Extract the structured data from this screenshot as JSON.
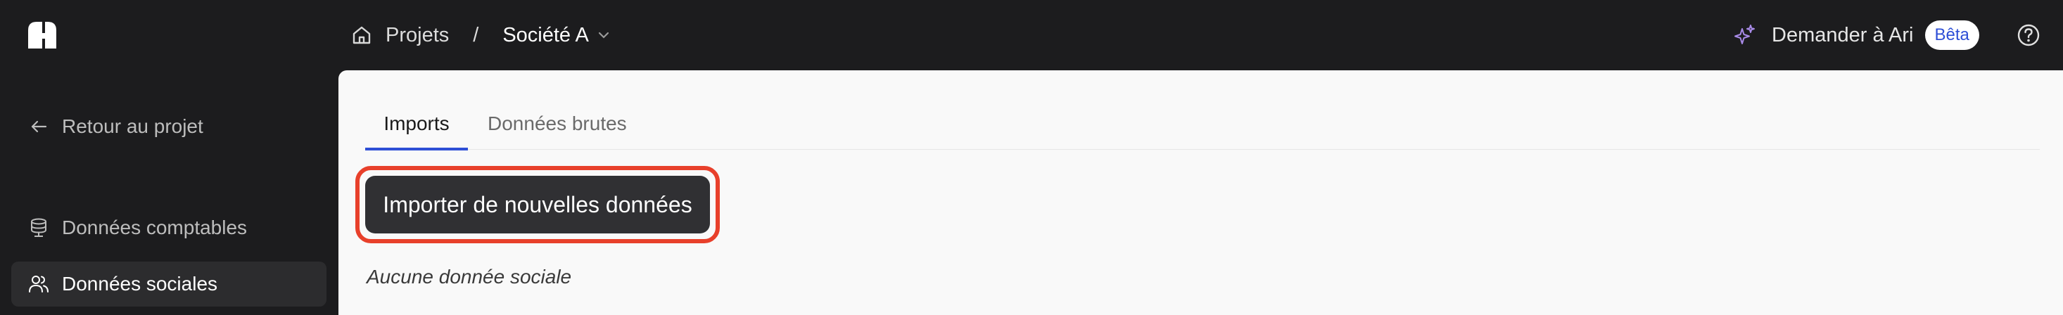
{
  "header": {
    "logo_icon": "app-logo-icon",
    "breadcrumb": {
      "home_icon": "home-icon",
      "projects_label": "Projets",
      "separator": "/",
      "current_label": "Société A",
      "dropdown_icon": "chevron-down-icon"
    },
    "ask_ari": {
      "icon": "sparkle-icon",
      "label": "Demander à Ari",
      "badge": "Bêta"
    },
    "help_icon": "help-circle-icon"
  },
  "sidebar": {
    "items": [
      {
        "icon": "arrow-left-icon",
        "label": "Retour au projet",
        "active": false
      },
      {
        "icon": "database-icon",
        "label": "Données comptables",
        "active": false
      },
      {
        "icon": "users-icon",
        "label": "Données sociales",
        "active": true
      }
    ]
  },
  "main": {
    "tabs": [
      {
        "label": "Imports",
        "active": true
      },
      {
        "label": "Données brutes",
        "active": false
      }
    ],
    "import_button_label": "Importer de nouvelles données",
    "empty_message": "Aucune donnée sociale"
  },
  "colors": {
    "accent": "#2e4fd6",
    "highlight_border": "#e8402b",
    "topbar_bg": "#1c1c1e",
    "panel_bg": "#f9f9f9"
  }
}
